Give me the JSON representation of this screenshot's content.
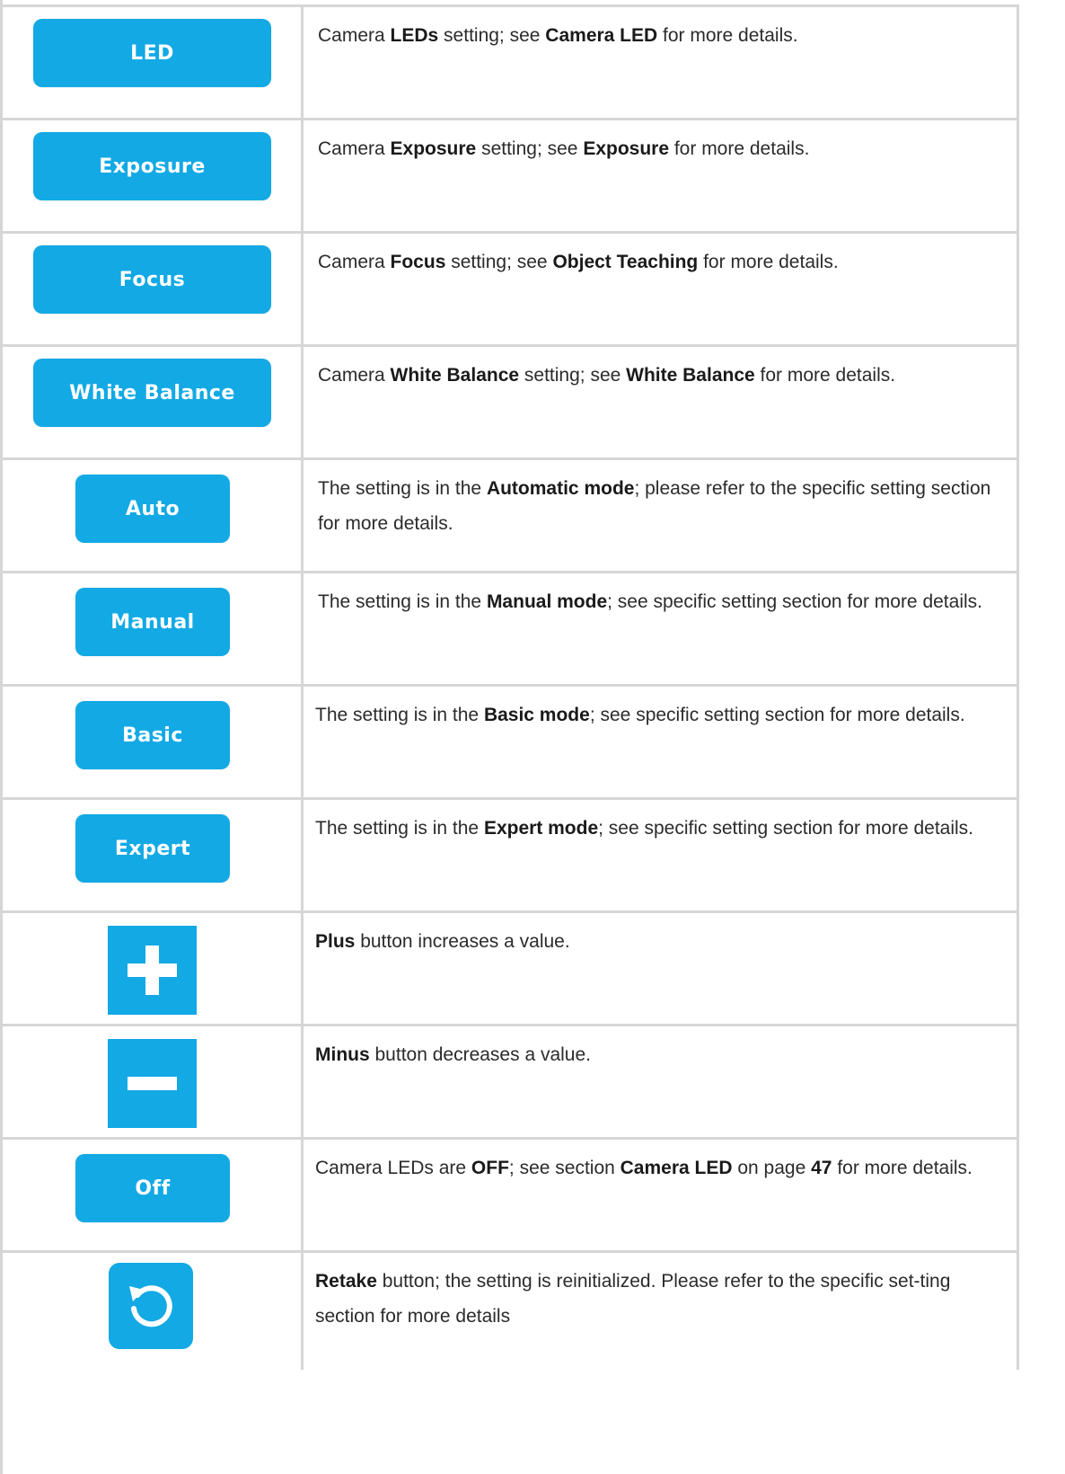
{
  "rows": [
    {
      "button": "LED",
      "desc": [
        {
          "t": "Camera "
        },
        {
          "b": "LEDs"
        },
        {
          "t": " setting; see "
        },
        {
          "b": "Camera LED"
        },
        {
          "t": " for more details."
        }
      ]
    },
    {
      "button": "Exposure",
      "desc": [
        {
          "t": "Camera "
        },
        {
          "b": "Exposure"
        },
        {
          "t": " setting; see "
        },
        {
          "b": "Exposure"
        },
        {
          "t": " for more details."
        }
      ]
    },
    {
      "button": "Focus",
      "desc": [
        {
          "t": "Camera "
        },
        {
          "b": "Focus"
        },
        {
          "t": " setting; see "
        },
        {
          "b": "Object Teaching"
        },
        {
          "t": " for more details."
        }
      ]
    },
    {
      "button": "White Balance",
      "desc": [
        {
          "t": "Camera "
        },
        {
          "b": "White Balance"
        },
        {
          "t": " setting; see "
        },
        {
          "b": "White Balance"
        },
        {
          "t": " for more details."
        }
      ]
    },
    {
      "button": "Auto",
      "desc": [
        {
          "t": "The setting is in the "
        },
        {
          "b": "Automatic mode"
        },
        {
          "t": "; please refer to the specific setting section for more details."
        }
      ]
    },
    {
      "button": "Manual",
      "desc": [
        {
          "t": "The setting is in the "
        },
        {
          "b": "Manual mode"
        },
        {
          "t": "; see specific setting section for more details."
        }
      ]
    },
    {
      "button": "Basic",
      "desc": [
        {
          "t": "The setting is in the "
        },
        {
          "b": "Basic mode"
        },
        {
          "t": "; see specific setting section for more details."
        }
      ]
    },
    {
      "button": "Expert",
      "desc": [
        {
          "t": "The setting is in the "
        },
        {
          "b": "Expert mode"
        },
        {
          "t": "; see specific setting section for more details."
        }
      ]
    },
    {
      "icon": "plus-icon",
      "desc": [
        {
          "b": "Plus"
        },
        {
          "t": " button increases a value."
        }
      ]
    },
    {
      "icon": "minus-icon",
      "desc": [
        {
          "b": "Minus"
        },
        {
          "t": " button decreases a value."
        }
      ]
    },
    {
      "button": "Off",
      "desc": [
        {
          "t": "Camera LEDs are "
        },
        {
          "b": "OFF"
        },
        {
          "t": "; see section "
        },
        {
          "b": "Camera LED"
        },
        {
          "t": " on page "
        },
        {
          "b": "47"
        },
        {
          "t": " for more details."
        }
      ]
    },
    {
      "icon": "retake-icon",
      "desc": [
        {
          "b": "Retake"
        },
        {
          "t": " button; the setting is reinitialized. Please refer to the specific set-ting section for more details"
        }
      ]
    }
  ],
  "colors": {
    "button_blue": "#12a9e5",
    "border": "#d6d6d6"
  }
}
